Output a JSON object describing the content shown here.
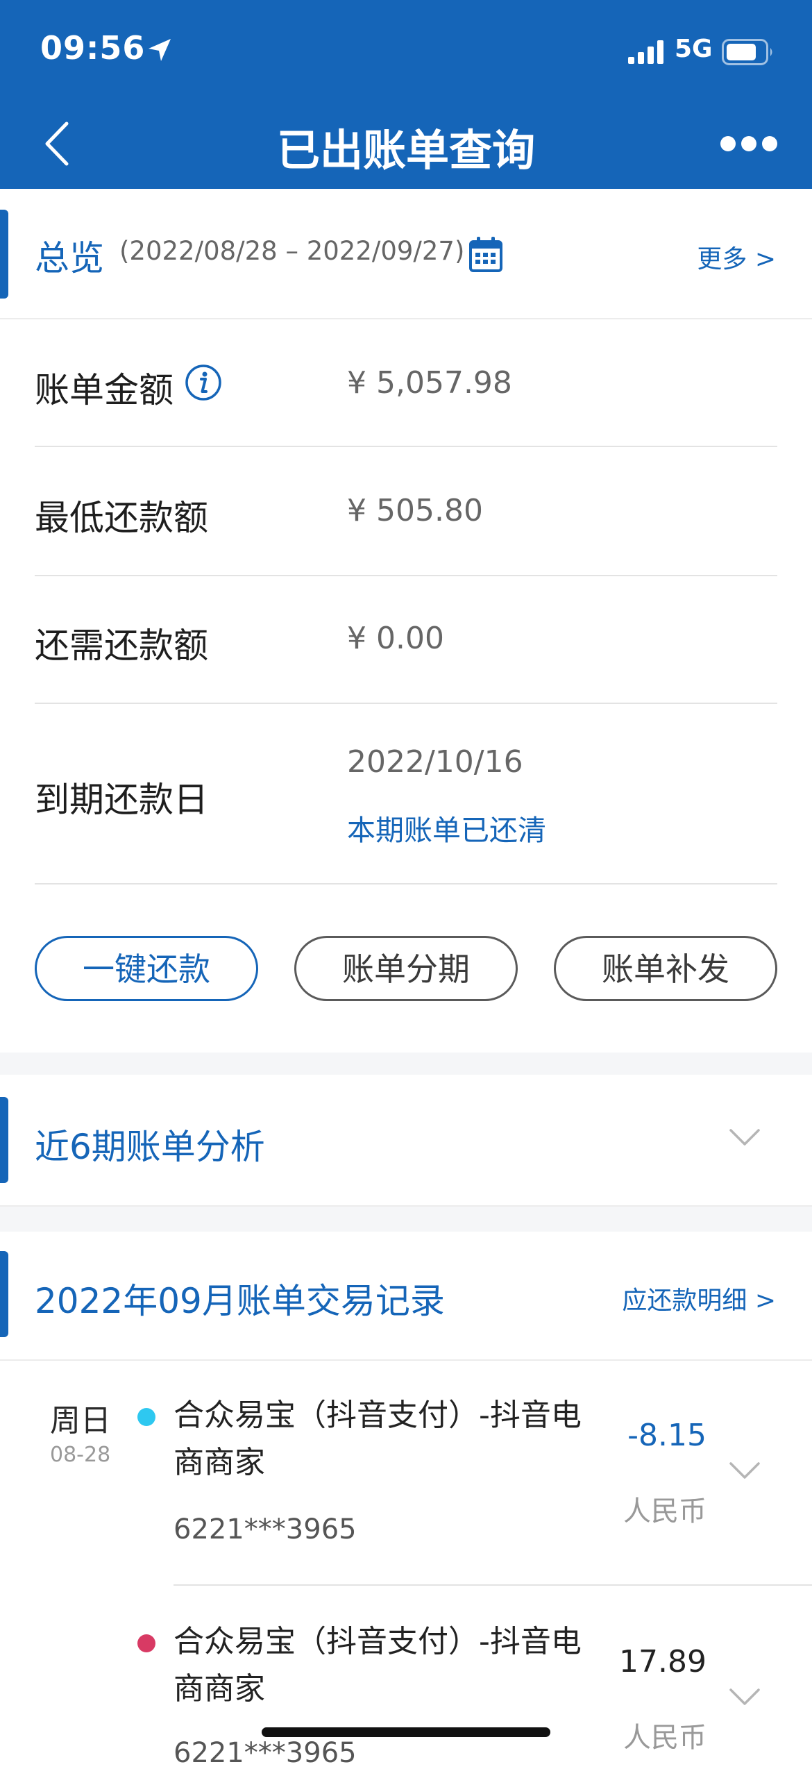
{
  "status_bar": {
    "time": "09:56",
    "network": "5G"
  },
  "nav": {
    "title": "已出账单查询"
  },
  "overview": {
    "title": "总览",
    "period": "(2022/08/28 – 2022/09/27)",
    "more_label": "更多 >",
    "rows": {
      "bill_amount": {
        "label": "账单金额",
        "value": "¥ 5,057.98"
      },
      "min_payment": {
        "label": "最低还款额",
        "value": "¥ 505.80"
      },
      "remaining": {
        "label": "还需还款额",
        "value": "¥ 0.00"
      },
      "due_date": {
        "label": "到期还款日",
        "value": "2022/10/16",
        "status": "本期账单已还清"
      }
    },
    "actions": {
      "repay": "一键还款",
      "installment": "账单分期",
      "resend": "账单补发"
    }
  },
  "analysis": {
    "title": "近6期账单分析"
  },
  "transactions": {
    "title": "2022年09月账单交易记录",
    "detail_link": "应还款明细 >",
    "items": [
      {
        "weekday": "周日",
        "date": "08-28",
        "merchant": "合众易宝（抖音支付）-抖音电商商家",
        "card": "6221***3965",
        "amount": "-8.15",
        "currency": "人民币",
        "dot_color": "#2ec8f0",
        "amount_color": "#1565b8"
      },
      {
        "weekday": "",
        "date": "",
        "merchant": "合众易宝（抖音支付）-抖音电商商家",
        "card": "6221***3965",
        "amount": "17.89",
        "currency": "人民币",
        "dot_color": "#d83a64",
        "amount_color": "#222222"
      }
    ]
  },
  "colors": {
    "brand_blue": "#1565b8",
    "refund_dot": "#2ec8f0",
    "purchase_dot": "#d83a64"
  }
}
